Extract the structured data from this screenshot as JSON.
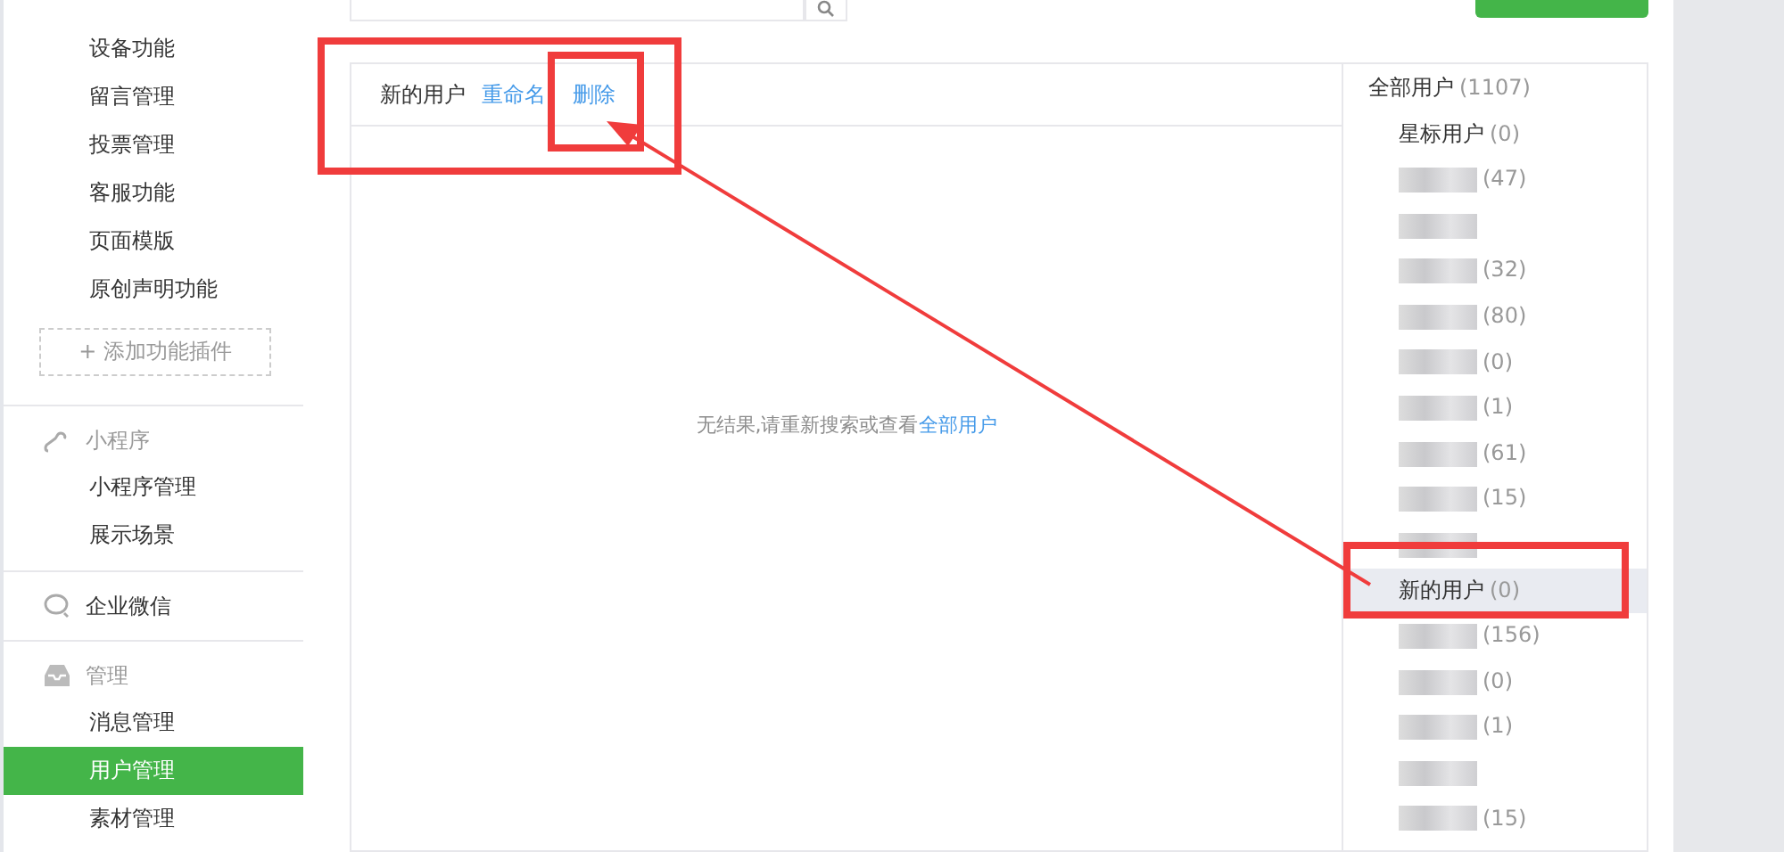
{
  "sidebar": {
    "groups": [
      {
        "items": [
          {
            "label": "设备功能",
            "selected": false
          },
          {
            "label": "留言管理",
            "selected": false
          },
          {
            "label": "投票管理",
            "selected": false
          },
          {
            "label": "客服功能",
            "selected": false
          },
          {
            "label": "页面模版",
            "selected": false
          },
          {
            "label": "原创声明功能",
            "selected": false
          }
        ],
        "add_button": {
          "icon": "+",
          "label": "添加功能插件"
        }
      },
      {
        "title": "小程序",
        "items": [
          {
            "label": "小程序管理",
            "selected": false
          },
          {
            "label": "展示场景",
            "selected": false
          }
        ]
      },
      {
        "title": "企业微信"
      },
      {
        "title": "管理",
        "items": [
          {
            "label": "消息管理",
            "selected": false
          },
          {
            "label": "用户管理",
            "selected": true
          },
          {
            "label": "素材管理",
            "selected": false
          }
        ]
      }
    ]
  },
  "panel": {
    "header": {
      "title": "新的用户",
      "actions": [
        "重命名",
        "删除"
      ]
    },
    "empty_message": {
      "text": "无结果,请重新搜索或查看",
      "link": "全部用户"
    },
    "tags": {
      "all": {
        "name": "全部用户",
        "count": "(1107)"
      },
      "items": [
        {
          "kind": "plain",
          "name": "星标用户",
          "count": "(0)",
          "selected": false
        },
        {
          "kind": "blurred",
          "count": "(47)",
          "selected": false
        },
        {
          "kind": "blurred",
          "selected": false
        },
        {
          "kind": "blurred",
          "count": "(32)",
          "selected": false
        },
        {
          "kind": "blurred",
          "count": "(80)",
          "selected": false
        },
        {
          "kind": "blurred",
          "count": "(0)",
          "selected": false
        },
        {
          "kind": "blurred",
          "count": "(1)",
          "selected": false
        },
        {
          "kind": "blurred",
          "count": "(61)",
          "selected": false
        },
        {
          "kind": "blurred",
          "count": "(15)",
          "selected": false
        },
        {
          "kind": "blurred",
          "selected": false
        },
        {
          "kind": "plain",
          "name": "新的用户",
          "count": "(0)",
          "selected": true
        },
        {
          "kind": "blurred",
          "count": "(156)",
          "selected": false
        },
        {
          "kind": "blurred",
          "count": "(0)",
          "selected": false
        },
        {
          "kind": "blurred",
          "count": "(1)",
          "selected": false
        },
        {
          "kind": "blurred",
          "selected": false
        },
        {
          "kind": "blurred",
          "count": "(15)",
          "selected": false
        }
      ]
    }
  }
}
